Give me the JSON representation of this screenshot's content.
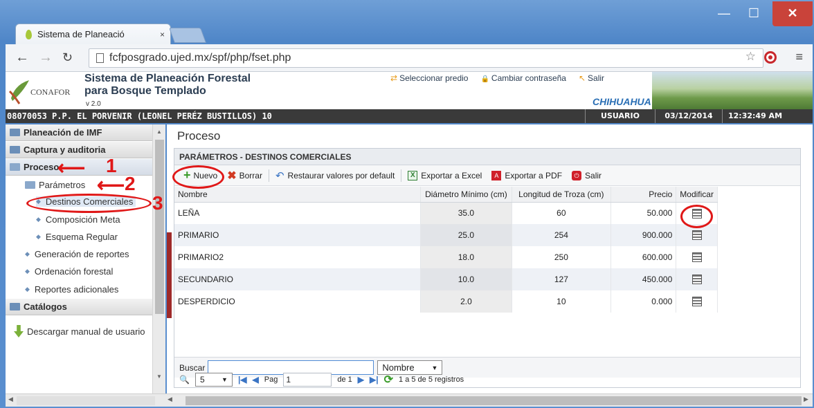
{
  "browser": {
    "tab_title": "Sistema de Planeació",
    "tab_close": "×",
    "url": "fcfposgrado.ujed.mx/spf/php/fset.php",
    "window_controls": {
      "minimize": "—",
      "maximize": "☐",
      "close": "✕"
    }
  },
  "header": {
    "logo_text": "CONAFOR",
    "title_line1": "Sistema de Planeación Forestal",
    "title_line2": "para Bosque Templado",
    "version": "v 2.0",
    "links": [
      {
        "icon": "⇄",
        "label": "Seleccionar predio"
      },
      {
        "icon": "🔒",
        "label": "Cambiar contraseña"
      },
      {
        "icon": "↖",
        "label": "Salir"
      }
    ],
    "state": "CHIHUAHUA"
  },
  "infobar": {
    "predio": "08070053 P.P. EL PORVENIR (LEONEL PERÉZ BUSTILLOS) 10",
    "user": "USUARIO",
    "date": "03/12/2014",
    "time": "12:32:49 AM"
  },
  "sidebar": {
    "sections": [
      "Planeación de IMF",
      "Captura y auditoria",
      "Proceso",
      "Catálogos"
    ],
    "parametros": "Parámetros",
    "items": [
      "Destinos Comerciales",
      "Composición Meta",
      "Esquema Regular",
      "Generación de reportes",
      "Ordenación forestal",
      "Reportes adicionales"
    ],
    "download": "Descargar manual de usuario"
  },
  "annotations": {
    "a1": "1",
    "a2": "2",
    "a3": "3",
    "colors": {
      "red": "#e01818"
    }
  },
  "main": {
    "page_title": "Proceso",
    "panel_title": "PARÁMETROS - DESTINOS COMERCIALES",
    "toolbar": {
      "nuevo": "Nuevo",
      "borrar": "Borrar",
      "restaurar": "Restaurar valores por default",
      "excel": "Exportar a Excel",
      "pdf": "Exportar a PDF",
      "salir": "Salir"
    },
    "columns": [
      "Nombre",
      "Diámetro Mínimo (cm)",
      "Longitud de Troza (cm)",
      "Precio",
      "Modificar"
    ],
    "rows": [
      {
        "nombre": "LEÑA",
        "diametro": "35.0",
        "longitud": "60",
        "precio": "50.000"
      },
      {
        "nombre": "PRIMARIO",
        "diametro": "25.0",
        "longitud": "254",
        "precio": "900.000"
      },
      {
        "nombre": "PRIMARIO2",
        "diametro": "18.0",
        "longitud": "250",
        "precio": "600.000"
      },
      {
        "nombre": "SECUNDARIO",
        "diametro": "10.0",
        "longitud": "127",
        "precio": "450.000"
      },
      {
        "nombre": "DESPERDICIO",
        "diametro": "2.0",
        "longitud": "10",
        "precio": "0.000"
      }
    ],
    "search": {
      "label": "Buscar",
      "value": "",
      "field": "Nombre"
    },
    "pager": {
      "page_size": "5",
      "pag_label": "Pag",
      "page": "1",
      "of_label": "de 1",
      "records": "1 a 5 de 5 registros"
    }
  }
}
